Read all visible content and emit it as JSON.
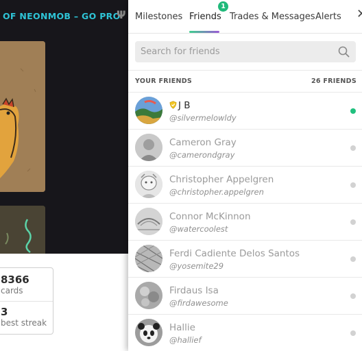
{
  "background": {
    "brand_text": "OF NEONMOB – GO PRO",
    "tier_glyph": "Ψ",
    "stats": [
      {
        "value": "8366",
        "label": "cards"
      },
      {
        "value": "3",
        "label": "best streak"
      }
    ]
  },
  "panel": {
    "tabs": [
      {
        "label": "Milestones"
      },
      {
        "label": "Friends",
        "badge": "1"
      },
      {
        "label": "Trades & Messages"
      },
      {
        "label": "Alerts"
      }
    ],
    "close_glyph": "✕",
    "search": {
      "placeholder": "Search for friends",
      "value": ""
    },
    "list_header": {
      "title": "YOUR FRIENDS",
      "count": "26 FRIENDS"
    },
    "friends": [
      {
        "name": "J B",
        "handle": "@silvermelowldy",
        "online": true,
        "pro": true
      },
      {
        "name": "Cameron Gray",
        "handle": "@camerondgray",
        "online": false
      },
      {
        "name": "Christopher Appelgren",
        "handle": "@christopher.appelgren",
        "online": false
      },
      {
        "name": "Connor McKinnon",
        "handle": "@watercoolest",
        "online": false
      },
      {
        "name": "Ferdi Cadiente Delos Santos",
        "handle": "@yosemite29",
        "online": false
      },
      {
        "name": "Firdaus Isa",
        "handle": "@firdawesome",
        "online": false
      },
      {
        "name": "Hallie",
        "handle": "@hallief",
        "online": false
      }
    ],
    "colors": {
      "online": "#20c07e",
      "offline": "#d2d2d2",
      "badge": "#20b97a",
      "brand": "#2ec4d6"
    }
  }
}
